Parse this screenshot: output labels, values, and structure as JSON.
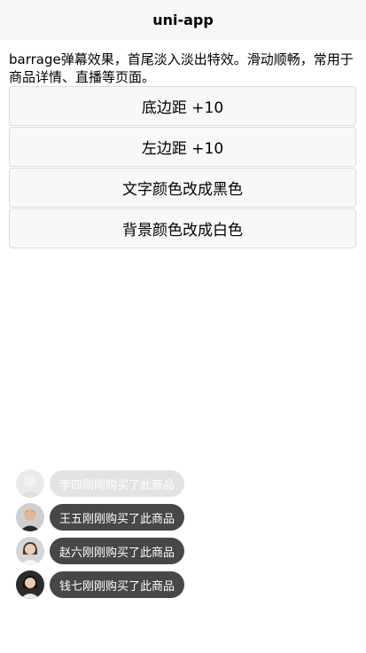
{
  "nav": {
    "title": "uni-app"
  },
  "description": "barrage弹幕效果，首尾淡入淡出特效。滑动顺畅，常用于商品详情、直播等页面。",
  "buttons": [
    {
      "label": "底边距 +10"
    },
    {
      "label": "左边距 +10"
    },
    {
      "label": "文字颜色改成黑色"
    },
    {
      "label": "背景颜色改成白色"
    }
  ],
  "barrage": [
    {
      "text": "李四刚刚购买了此商品",
      "avatar": "user-avatar-icon",
      "state": "fading"
    },
    {
      "text": "王五刚刚购买了此商品",
      "avatar": "user-avatar-icon"
    },
    {
      "text": "赵六刚刚购买了此商品",
      "avatar": "user-avatar-icon"
    },
    {
      "text": "钱七刚刚购买了此商品",
      "avatar": "user-avatar-icon"
    }
  ]
}
